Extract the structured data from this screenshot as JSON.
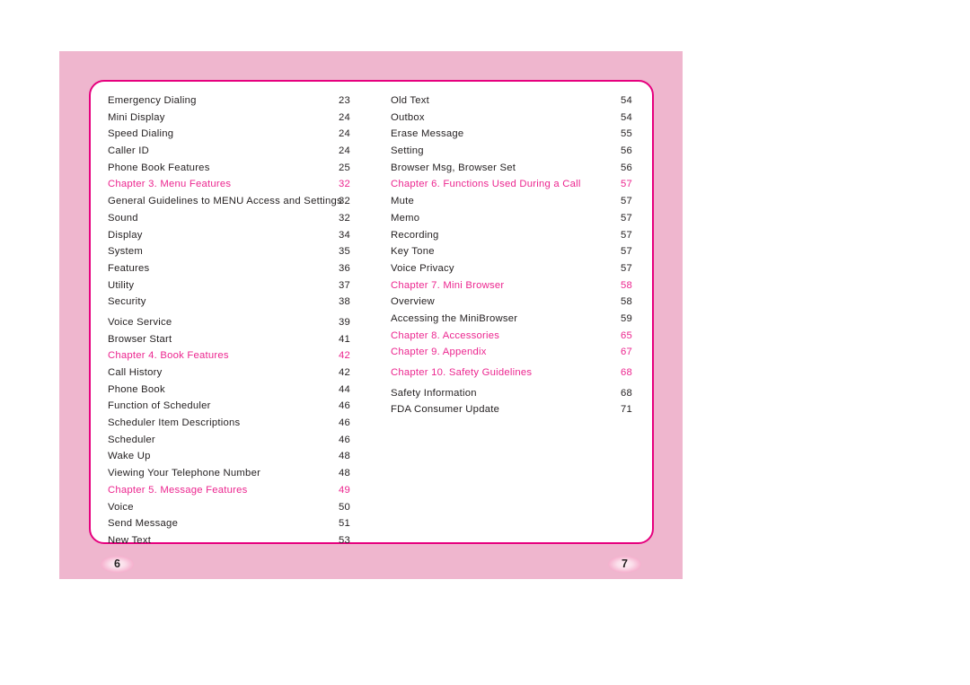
{
  "document": {
    "kind": "table-of-contents",
    "colors": {
      "panel_pink": "#efb6ce",
      "card_white": "#ffffff",
      "accent_magenta": "#ec268f",
      "border_magenta": "#e6007e",
      "body_text": "#231f20"
    }
  },
  "toc": {
    "left_column": [
      {
        "title": "Emergency Dialing",
        "page": "23",
        "chapter": false
      },
      {
        "title": "Mini Display",
        "page": "24",
        "chapter": false
      },
      {
        "title": "Speed Dialing",
        "page": "24",
        "chapter": false
      },
      {
        "title": "Caller ID",
        "page": "24",
        "chapter": false
      },
      {
        "title": "Phone Book Features",
        "page": "25",
        "chapter": false
      },
      {
        "title": "Chapter 3. Menu Features",
        "page": "32",
        "chapter": true
      },
      {
        "title": "General Guidelines to MENU Access and Settings",
        "page": "32",
        "chapter": false
      },
      {
        "title": "Sound",
        "page": "32",
        "chapter": false
      },
      {
        "title": "Display",
        "page": "34",
        "chapter": false
      },
      {
        "title": "System",
        "page": "35",
        "chapter": false
      },
      {
        "title": "Features",
        "page": "36",
        "chapter": false
      },
      {
        "title": "Utility",
        "page": "37",
        "chapter": false
      },
      {
        "title": "Security",
        "page": "38",
        "chapter": false
      },
      {
        "title": "Voice Service",
        "page": "39",
        "chapter": false
      },
      {
        "title": "Browser Start",
        "page": "41",
        "chapter": false
      },
      {
        "title": "Chapter 4. Book Features",
        "page": "42",
        "chapter": true
      },
      {
        "title": "Call History",
        "page": "42",
        "chapter": false
      },
      {
        "title": "Phone Book",
        "page": "44",
        "chapter": false
      },
      {
        "title": "Function of Scheduler",
        "page": "46",
        "chapter": false
      },
      {
        "title": "Scheduler Item Descriptions",
        "page": "46",
        "chapter": false
      },
      {
        "title": "Scheduler",
        "page": "46",
        "chapter": false
      },
      {
        "title": "Wake Up",
        "page": "48",
        "chapter": false
      },
      {
        "title": "Viewing Your Telephone Number",
        "page": "48",
        "chapter": false
      },
      {
        "title": "Chapter 5. Message Features",
        "page": "49",
        "chapter": true
      },
      {
        "title": "Voice",
        "page": "50",
        "chapter": false
      },
      {
        "title": "Send  Message",
        "page": "51",
        "chapter": false
      },
      {
        "title": "New Text",
        "page": "53",
        "chapter": false
      }
    ],
    "right_column": [
      {
        "title": "Old Text",
        "page": "54",
        "chapter": false
      },
      {
        "title": "Outbox",
        "page": "54",
        "chapter": false
      },
      {
        "title": "Erase Message",
        "page": "55",
        "chapter": false
      },
      {
        "title": "Setting",
        "page": "56",
        "chapter": false
      },
      {
        "title": "Browser Msg, Browser Set",
        "page": "56",
        "chapter": false
      },
      {
        "title": "Chapter 6. Functions Used During a Call",
        "page": "57",
        "chapter": true
      },
      {
        "title": "Mute",
        "page": "57",
        "chapter": false
      },
      {
        "title": "Memo",
        "page": "57",
        "chapter": false
      },
      {
        "title": "Recording",
        "page": "57",
        "chapter": false
      },
      {
        "title": "Key Tone",
        "page": "57",
        "chapter": false
      },
      {
        "title": "Voice Privacy",
        "page": "57",
        "chapter": false
      },
      {
        "title": "Chapter 7. Mini Browser",
        "page": "58",
        "chapter": true
      },
      {
        "title": "Overview",
        "page": "58",
        "chapter": false
      },
      {
        "title": "Accessing the MiniBrowser",
        "page": "59",
        "chapter": false
      },
      {
        "title": "Chapter 8. Accessories",
        "page": "65",
        "chapter": true
      },
      {
        "title": "Chapter 9. Appendix",
        "page": "67",
        "chapter": true
      },
      {
        "title": "Chapter 10. Safety Guidelines",
        "page": "68",
        "chapter": true
      },
      {
        "title": "Safety Information",
        "page": "68",
        "chapter": false
      },
      {
        "title": "FDA Consumer Update",
        "page": "71",
        "chapter": false
      }
    ]
  },
  "page_badges": {
    "left": "6",
    "right": "7"
  }
}
